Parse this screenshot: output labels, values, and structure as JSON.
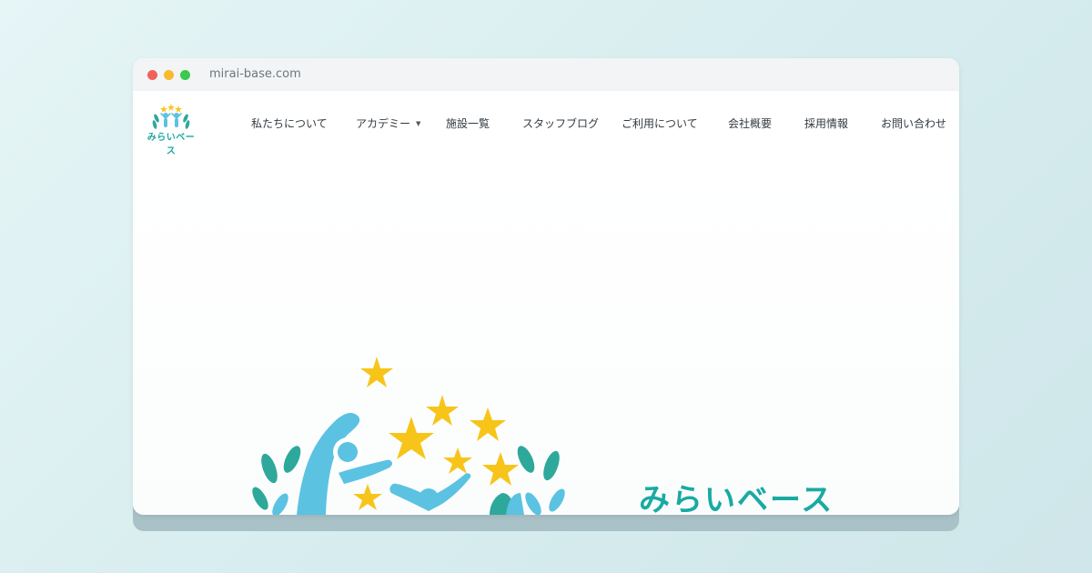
{
  "browser": {
    "url": "mirai-base.com"
  },
  "site": {
    "logo_text": "みらいベース",
    "brand_name": "みらいベース"
  },
  "nav": {
    "items": [
      {
        "label": "私たちについて"
      },
      {
        "label": "アカデミー",
        "has_dropdown": true
      },
      {
        "label": "施設一覧"
      },
      {
        "label": "スタッフブログ"
      },
      {
        "label": "ご利用について"
      },
      {
        "label": "会社概要"
      },
      {
        "label": "採用情報"
      },
      {
        "label": "お問い合わせ"
      }
    ],
    "dropdown_caret": "▼"
  },
  "colors": {
    "brand_teal": "#19aaa2",
    "star_yellow": "#f7c51a",
    "figure_blue": "#5bc2e2",
    "leaf_green": "#2ea89b"
  },
  "icons": [
    "window-close-dot",
    "window-minimize-dot",
    "window-maximize-dot",
    "star-icon",
    "leaf-icon",
    "person-figure-icon"
  ]
}
